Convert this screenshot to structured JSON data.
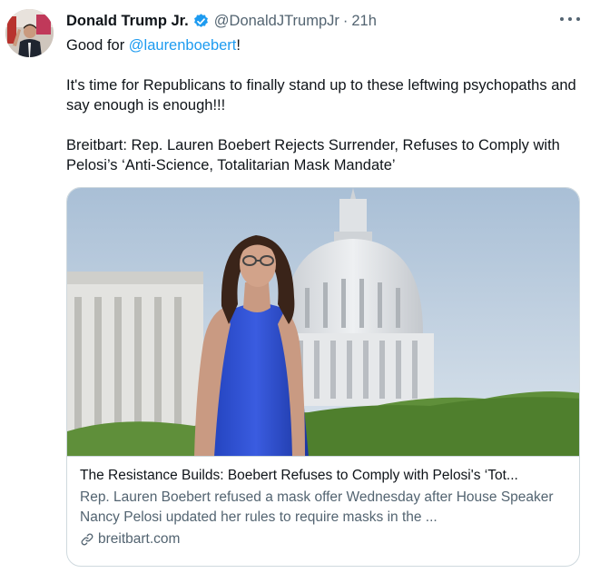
{
  "tweet": {
    "author_name": "Donald Trump Jr.",
    "handle": "@DonaldJTrumpJr",
    "separator": "·",
    "time": "21h",
    "text_line1_prefix": "Good for ",
    "text_line1_mention": "@laurenboebert",
    "text_line1_suffix": "!",
    "text_para2": "It's time for Republicans to finally stand up to these leftwing psychopaths and say enough is enough!!!",
    "text_para3": "Breitbart: Rep. Lauren Boebert Rejects Surrender, Refuses to Comply with Pelosi’s ‘Anti-Science, Totalitarian Mask Mandate’"
  },
  "card": {
    "title": "The Resistance Builds: Boebert Refuses to Comply with Pelosi's ‘Tot...",
    "description": "Rep. Lauren Boebert refused a mask offer Wednesday after House Speaker Nancy Pelosi updated her rules to require masks in the ...",
    "domain": "breitbart.com"
  },
  "icons": {
    "verified": "verified-badge-icon",
    "more": "more-options-icon",
    "link": "link-icon"
  },
  "colors": {
    "accent": "#1d9bf0",
    "secondary_text": "#536471",
    "border": "#cfd9de"
  }
}
